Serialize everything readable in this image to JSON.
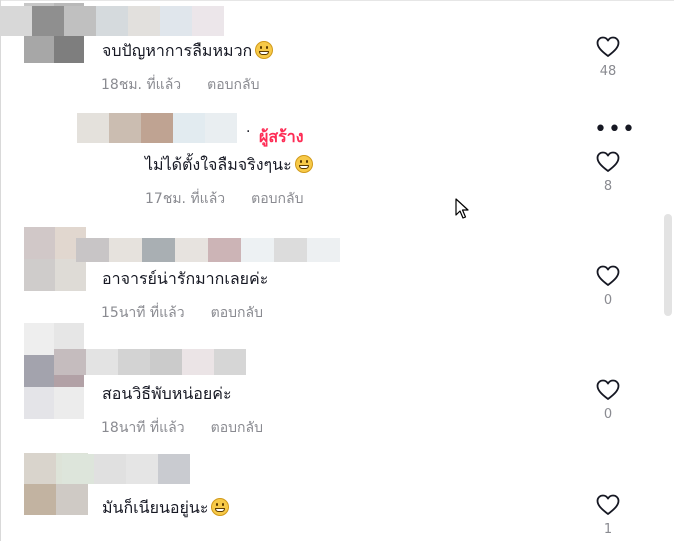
{
  "comments": [
    {
      "text": "จบปัญหาการลืมหมวก",
      "time": "18ชม. ที่แล้ว",
      "reply": "ตอบกลับ",
      "likes": "48",
      "emoji": "grinning-emoji"
    },
    {
      "text": "ไม่ได้ตั้งใจลืมจริงๆนะ",
      "time": "17ชม. ที่แล้ว",
      "reply": "ตอบกลับ",
      "likes": "8",
      "emoji": "laughing-emoji",
      "creator_separator": "·",
      "creator_label": "ผู้สร้าง"
    },
    {
      "text": "อาจารย์น่ารักมากเลยค่ะ",
      "time": "15นาที ที่แล้ว",
      "reply": "ตอบกลับ",
      "likes": "0"
    },
    {
      "text": "สอนวิธีพับหน่อยค่ะ",
      "time": "18นาที ที่แล้ว",
      "reply": "ตอบกลับ",
      "likes": "0"
    },
    {
      "text": "มันก็เนียนอยู่นะ",
      "likes": "1",
      "emoji": "laughing-emoji"
    }
  ],
  "icons": {
    "like": "heart-outline-icon",
    "more": "more-options-icon",
    "cursor": "mouse-cursor-icon"
  },
  "colors": {
    "creator": "#fe2c55",
    "meta": "#8a8b91",
    "text": "#161823"
  }
}
